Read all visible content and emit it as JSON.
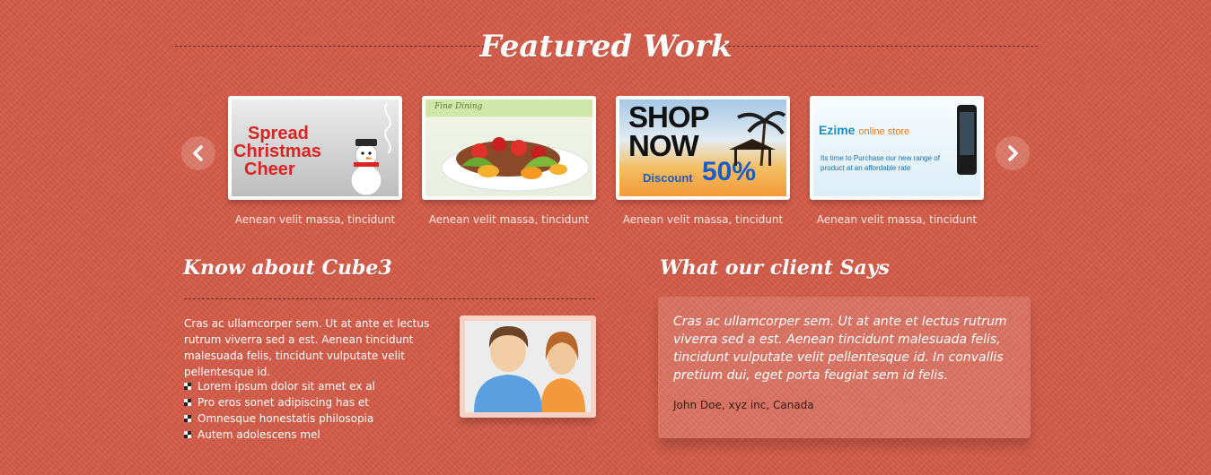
{
  "featured": {
    "title": "Featured Work",
    "items": [
      {
        "caption": "Aenean velit massa, tincidunt",
        "image_text": [
          "Spread",
          "Christmas",
          "Cheer"
        ]
      },
      {
        "caption": "Aenean velit massa, tincidunt",
        "image_text": [
          "Fine Dining"
        ]
      },
      {
        "caption": "Aenean velit massa, tincidunt",
        "image_text": [
          "SHOP",
          "NOW",
          "Discount",
          "50%"
        ]
      },
      {
        "caption": "Aenean velit massa, tincidunt",
        "image_text": [
          "Ezime",
          "online store",
          "Its time to Purchase our new range of product at an affordable rate"
        ]
      }
    ]
  },
  "about": {
    "title": "Know about Cube3",
    "paragraph": "Cras ac ullamcorper sem. Ut at ante et lectus rutrum viverra sed a est. Aenean tincidunt malesuada felis, tincidunt vulputate velit pellentesque id.",
    "list": [
      "Lorem ipsum dolor sit amet ex al",
      "Pro eros sonet adipiscing has et",
      "Omnesque honestatis philosopia",
      "Autem adolescens mel"
    ]
  },
  "testimonial": {
    "title": "What our client Says",
    "quote": "Cras ac ullamcorper sem. Ut at ante et lectus rutrum viverra sed a est. Aenean tincidunt malesuada felis, tincidunt vulputate velit pellentesque id. In convallis pretium dui, eget porta feugiat sem id felis.",
    "author": "John Doe, xyz inc, Canada"
  },
  "icons": {
    "prev": "chevron-left-icon",
    "next": "chevron-right-icon",
    "avatar": "users-avatar-icon",
    "bullet": "checker-bullet-icon"
  },
  "colors": {
    "background": "#d35a47",
    "accent_dark": "#3a1a14"
  }
}
